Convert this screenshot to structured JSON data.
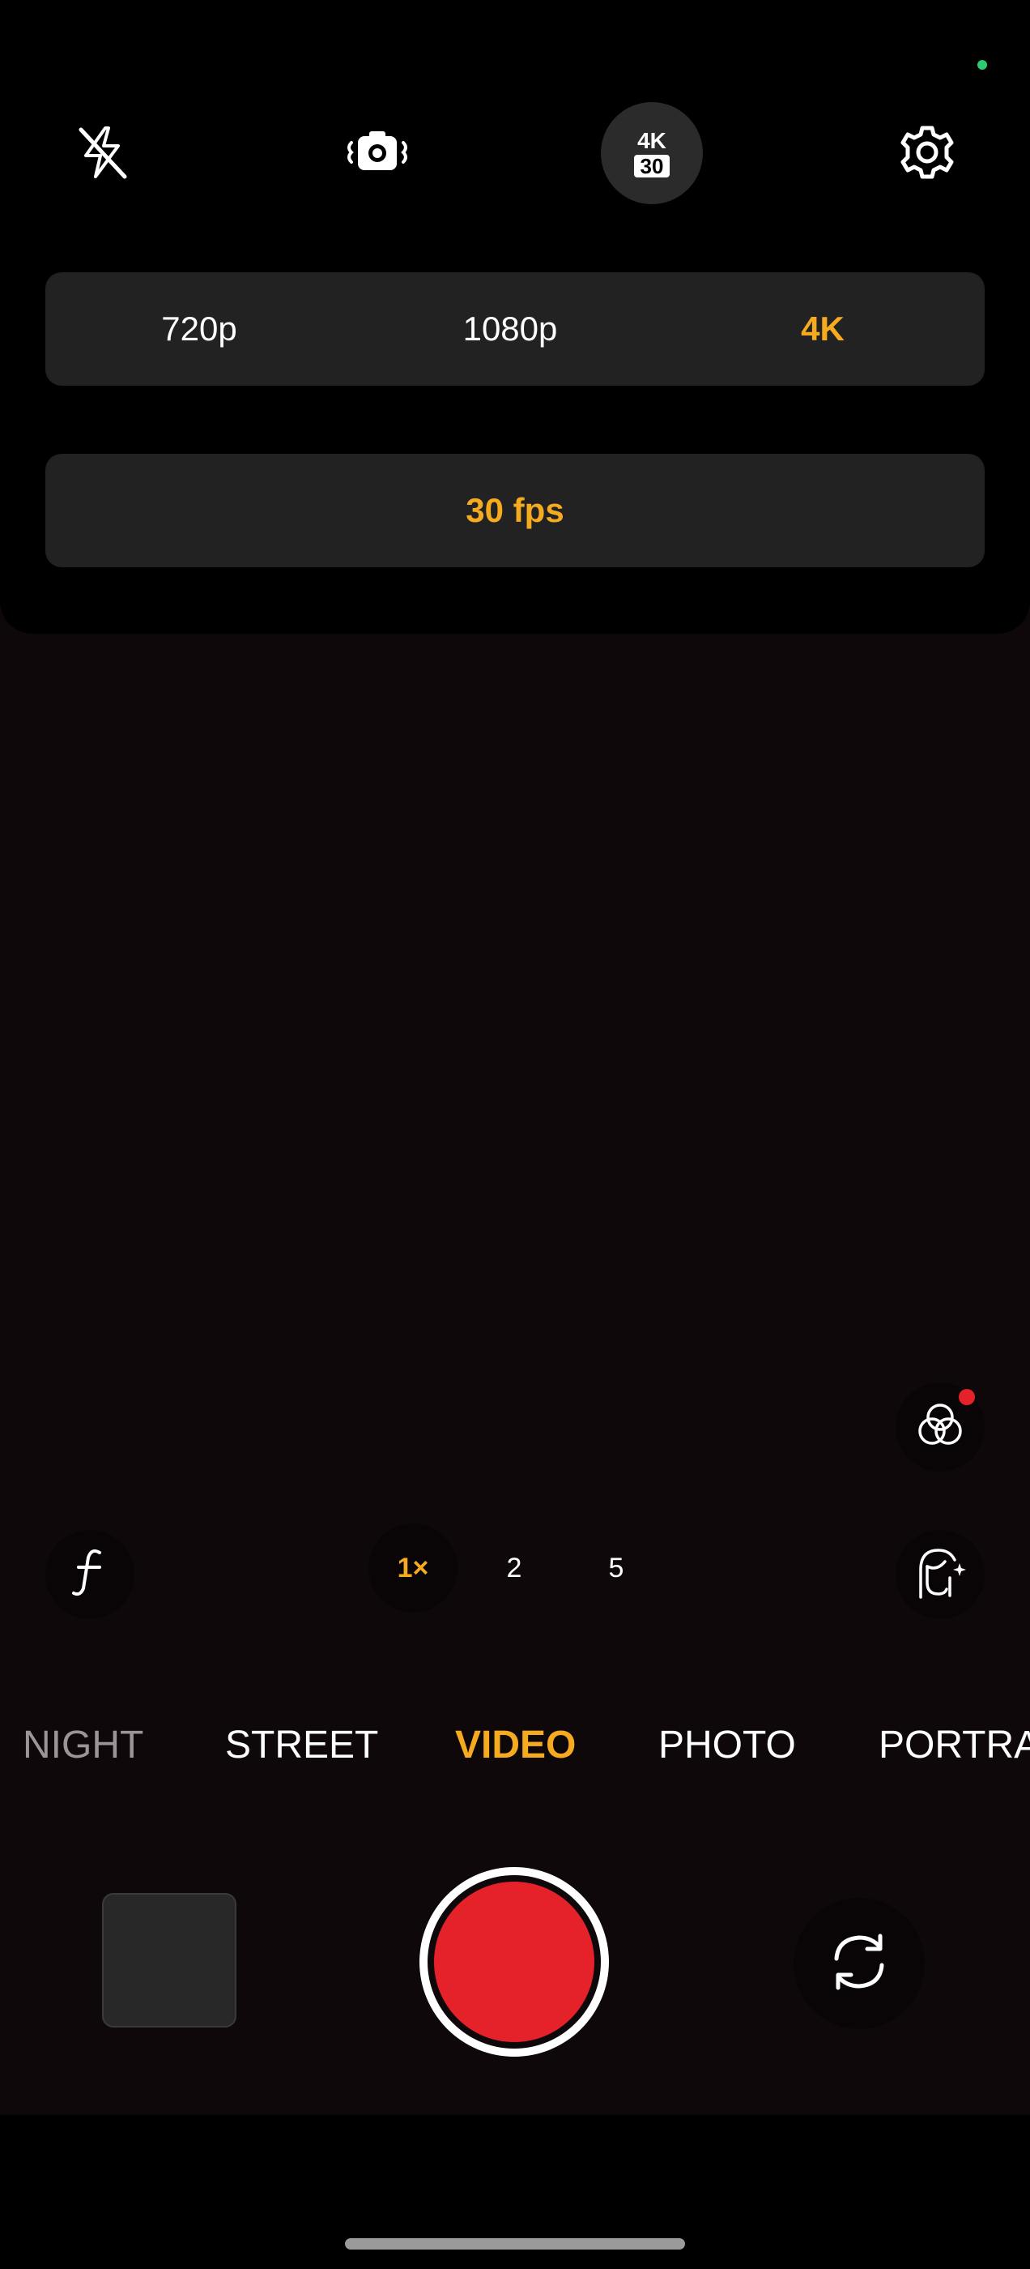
{
  "colors": {
    "accent": "#f6aa1f",
    "record": "#e5222a",
    "status_dot": "#2ecc71",
    "notification": "#e5222a"
  },
  "top_bar": {
    "icons": [
      "flash-off-icon",
      "stabilization-icon",
      "video-quality-badge",
      "settings-icon"
    ],
    "quality_badge": {
      "resolution": "4K",
      "fps": "30"
    }
  },
  "resolution": {
    "options": [
      "720p",
      "1080p",
      "4K"
    ],
    "selected": "4K"
  },
  "frame_rate": {
    "label": "30 fps"
  },
  "side_controls": {
    "left": "focus-f-icon",
    "right_top": "filters-icon",
    "right_bottom": "beauty-icon"
  },
  "zoom": {
    "options": [
      "1×",
      "2",
      "5"
    ],
    "selected": "1×"
  },
  "modes": {
    "items": [
      "NIGHT",
      "STREET",
      "VIDEO",
      "PHOTO",
      "PORTRA"
    ],
    "selected": "VIDEO"
  },
  "bottom": {
    "icons": [
      "gallery-thumbnail",
      "record-button",
      "switch-camera-icon"
    ]
  }
}
